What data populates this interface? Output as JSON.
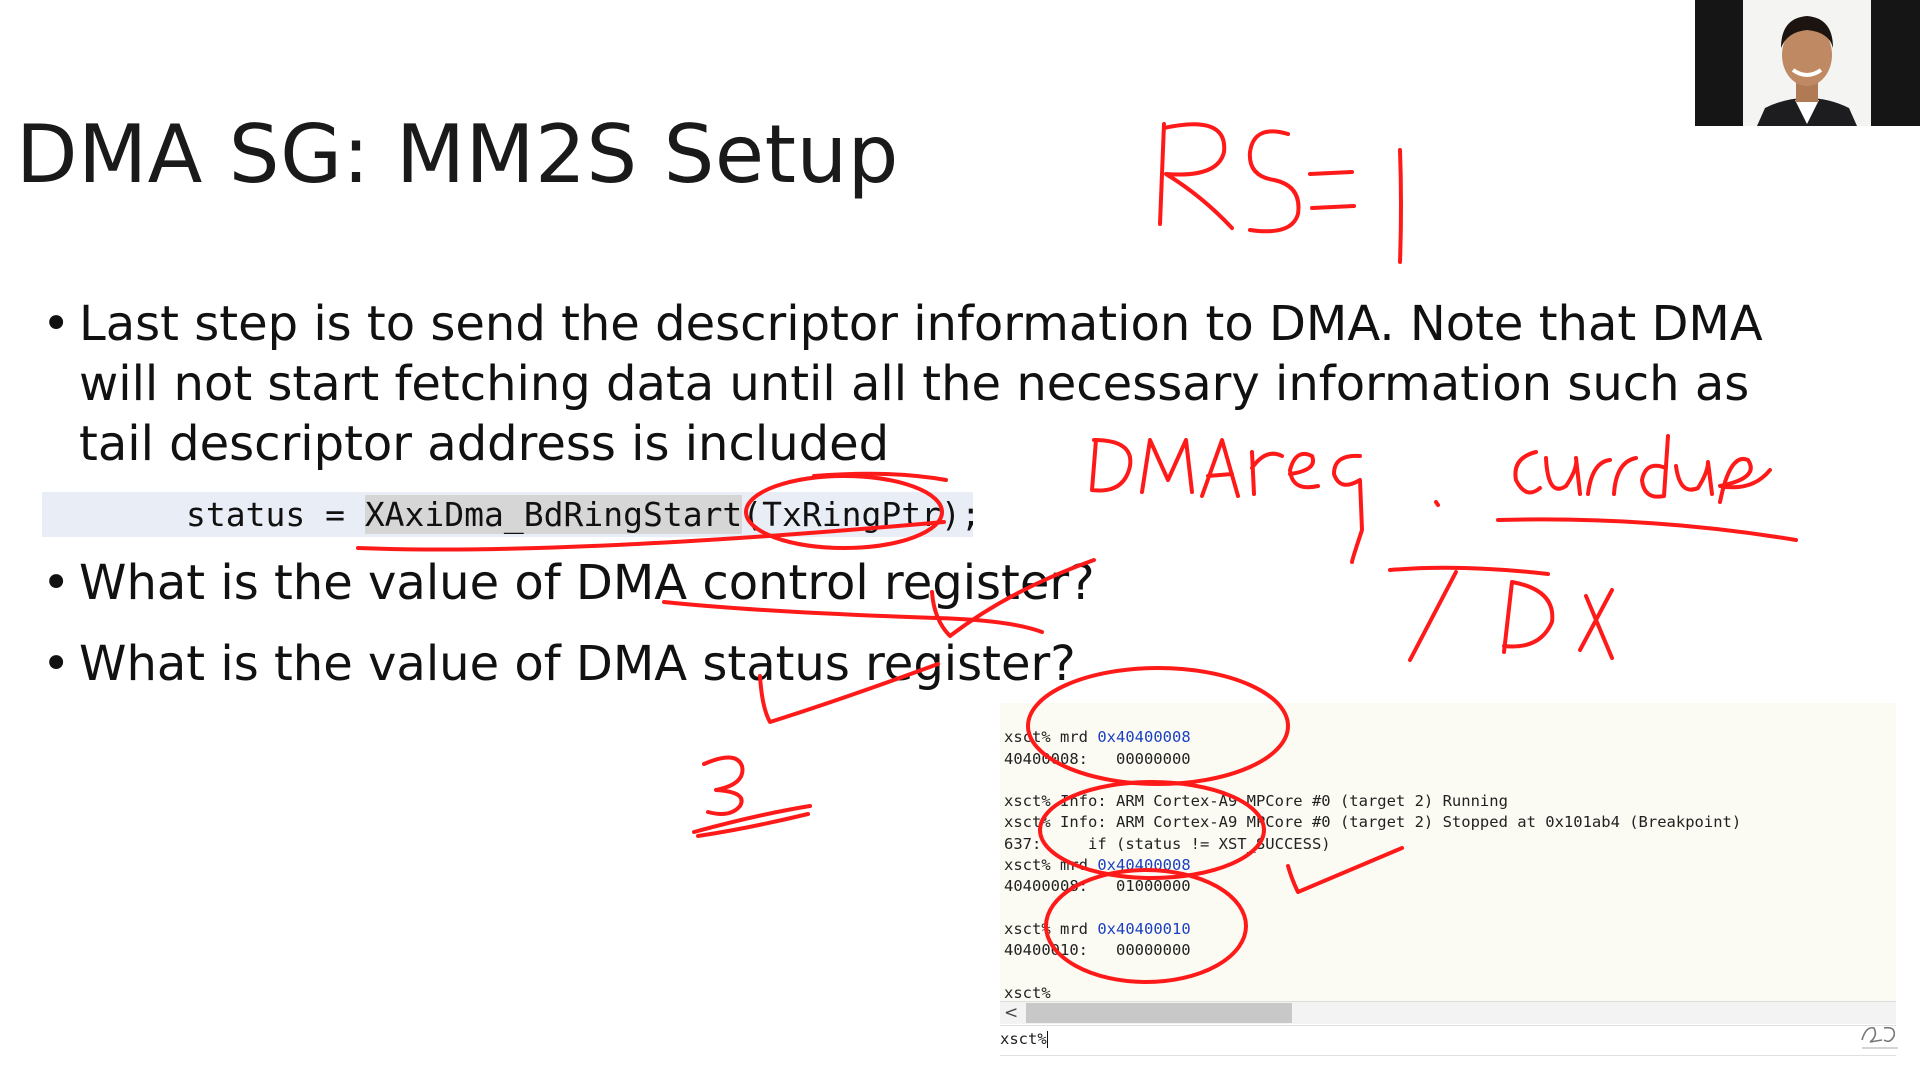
{
  "slide": {
    "title": "DMA SG: MM2S Setup",
    "bullets": [
      {
        "marker": "•",
        "lines": [
          "Last step is to send the descriptor information to DMA. Note that DMA",
          "will not start fetching data until all the necessary information such as",
          "tail descriptor address is included"
        ]
      },
      {
        "marker": "•",
        "lines": [
          "What is the value of DMA control register?"
        ]
      },
      {
        "marker": "•",
        "lines": [
          "What is the value of DMA status register?"
        ]
      }
    ],
    "code": {
      "prefix": "status = ",
      "highlighted": "XAxiDma_BdRingStart",
      "suffix": "(TxRingPtr);"
    }
  },
  "console": {
    "lines": [
      {
        "text": "xsct% mrd ",
        "addr": "0x40400008"
      },
      {
        "text": "40400008:   00000000"
      },
      {
        "text": ""
      },
      {
        "text": "xsct% Info: ARM Cortex-A9 MPCore #0 (target 2) Running"
      },
      {
        "text": "xsct% Info: ARM Cortex-A9 MPCore #0 (target 2) Stopped at 0x101ab4 (Breakpoint)"
      },
      {
        "text": "637:     if (status != XST_SUCCESS)"
      },
      {
        "text": "xsct% mrd ",
        "addr": "0x40400008"
      },
      {
        "text": "40400008:   01000000"
      },
      {
        "text": ""
      },
      {
        "text": "xsct% mrd ",
        "addr": "0x40400010"
      },
      {
        "text": "40400010:   00000000"
      },
      {
        "text": ""
      },
      {
        "text": "xsct%"
      }
    ],
    "scroll_left_arrow": "<",
    "prompt": "xsct%"
  },
  "colors": {
    "ink": "#ff1a1a",
    "address": "#1c3fbf",
    "console_background": "#fbfbf3",
    "code_band": "#e9edf5"
  },
  "icons": {
    "webcam": "presenter-webcam-video",
    "logo": "channel-watermark-logo"
  }
}
